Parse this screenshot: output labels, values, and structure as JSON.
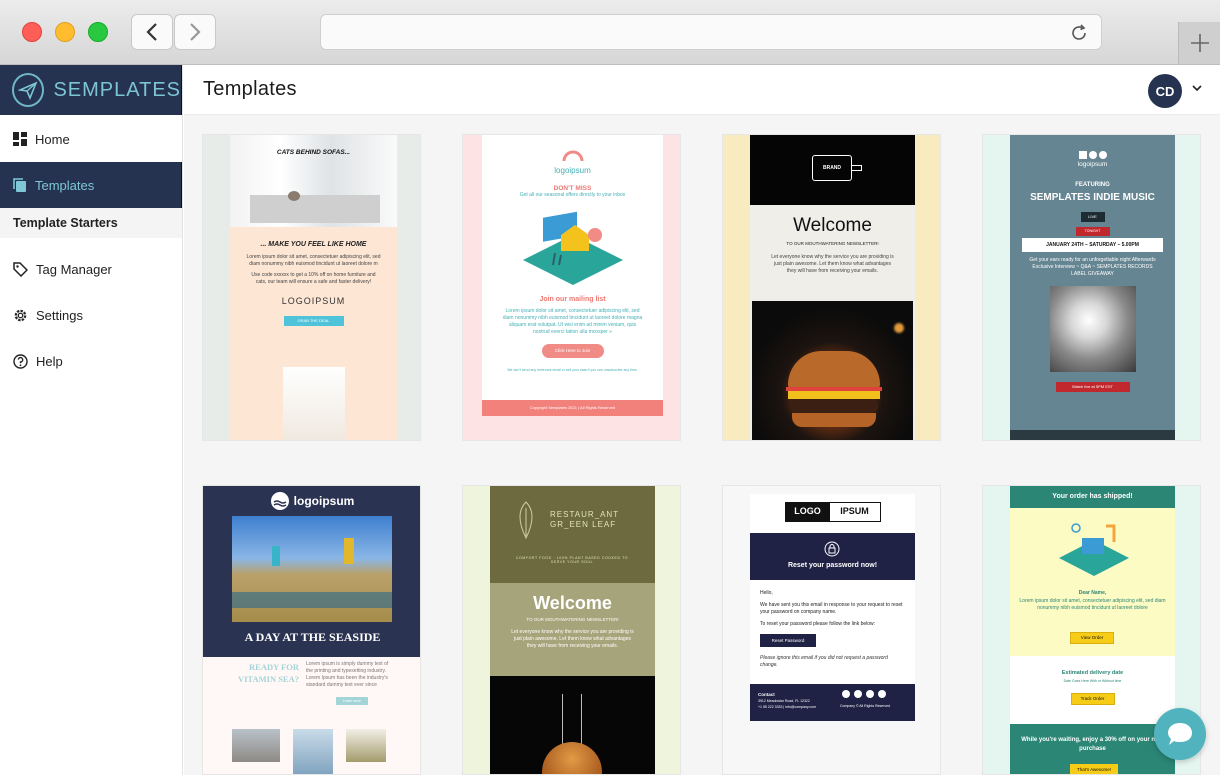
{
  "app": {
    "name": "SEMPLATES",
    "page_title": "Templates",
    "user_initials": "CD"
  },
  "sidebar": {
    "items": [
      {
        "label": "Home",
        "icon": "dashboard-icon"
      },
      {
        "label": "Templates",
        "icon": "copy-icon",
        "active": true
      },
      {
        "label": "Template Starters",
        "sub": true
      },
      {
        "label": "Tag Manager",
        "icon": "tag-icon"
      },
      {
        "label": "Settings",
        "icon": "gear-icon"
      },
      {
        "label": "Help",
        "icon": "help-icon"
      }
    ]
  },
  "colors": {
    "navy": "#253250",
    "teal": "#7cc5d4",
    "chat": "#50b3bd"
  },
  "templates": {
    "cats": {
      "headline": "CATS BEHIND SOFAS...",
      "sub": "... MAKE YOU FEEL LIKE HOME",
      "body": "Lorem ipsum dolor sit amet, consectetuer adipiscing elit, sed diam nonummy nibh euismod tincidunt ut laoreet dolore m",
      "promo": "Use code xxxxxx to get a 10% off on home furniture and cats, our team will ensure a safe and faster delivery!",
      "logo": "LOGOIPSUM",
      "button": "GRAB THE DEAL"
    },
    "mailing": {
      "logo": "logoipsum",
      "dont_miss": "DON'T MISS",
      "tagline": "Get all our seasonal offers directly to your inbox",
      "heading": "Join our mailing list",
      "body": "Lorem ipsum dolor sit amet, consectetuer adipiscing elit, sed diam nonummy nibh euismod tincidunt ut laoreet dolore magna aliquam erat volutpat. Ut wisi enim ad minim veniam, quis nostrud exerci tation ulla mcosper »",
      "button": "Click Here to Join",
      "note": "We don't send any irrelevant email or sell your data if you can unsubscribe any time.",
      "footer": "Copyright Semplates 2021 | All Rights Reserved"
    },
    "burger": {
      "brand": "BRAND",
      "welcome": "Welcome",
      "sub": "TO OUR MOUTHWATERING NEWSLETTER!",
      "body": "Let everyone know why the service you are providing is just plain awesome. Let them know what advantages they will have from receiving your emails."
    },
    "music": {
      "logo": "logoipsum",
      "featuring": "FEATURING",
      "title": "SEMPLATES INDIE MUSIC",
      "live": "LIVE",
      "tonight": "TONIGHT",
      "date": "JANUARY 24TH – SATURDAY – 5.00PM",
      "desc": "Get your ears ready for an unforgettable night Afterwards Exclusive Interview ~ Q&A ~ SEMPLATES RECORDS LABEL GIVEAWAY",
      "button": "Watch live at 5PM EST"
    },
    "seaside": {
      "logo": "logoipsum",
      "title": "A DAY AT THE SEASIDE",
      "ready": "READY FOR VITAMIN SEA?",
      "body": "Lorem ipsum is simply dummy text of the printing and typesetting industry. Lorem Ipsum has been the industry's standard dummy text ever since",
      "button": "Learn more"
    },
    "restaurant": {
      "name": "RESTAUR_ANT GR_EEN LEAF",
      "tagline": "COMFORT FOOD · 100% PLANT BASED COOKED TO SERVE YOUR SOUL",
      "welcome": "Welcome",
      "sub": "TO OUR MOUTHWATERING NEWSLETTER!",
      "body": "Let everyone know why the service you are providing is just plain awesome. Let them know what advantages they will have from receiving your emails."
    },
    "reset": {
      "logo_left": "LOGO",
      "logo_right": "IPSUM",
      "heading": "Reset your password now!",
      "hello": "Hello,",
      "body": "We have sent you this email in response to your request to reset your password on company name.",
      "follow": "To reset your password please follow the link below:",
      "button": "Reset Password",
      "ignore": "Please ignore this email if you did not request a password change.",
      "contact": "Contact",
      "address": "3912 Meadowlar Road, FL 12322",
      "phone": "+1 55 222 3333 | info@company.com",
      "copyright": "Company © All Rights Reserved"
    },
    "shipped": {
      "header": "Your order has shipped!",
      "dear": "Dear Name,",
      "body": "Lorem ipsum dolor sit amet, consectetuer adipiscing elit, sed diam nonummy nibh euismod tincidunt ut laoreet dolore",
      "view": "View Order",
      "delivery": "Estimated delivery date",
      "date_note": "Date Goes Here With or Without time",
      "track": "Track Order",
      "promo": "While you're waiting, enjoy a 30% off on your next purchase",
      "button": "That's Awesome!"
    }
  }
}
